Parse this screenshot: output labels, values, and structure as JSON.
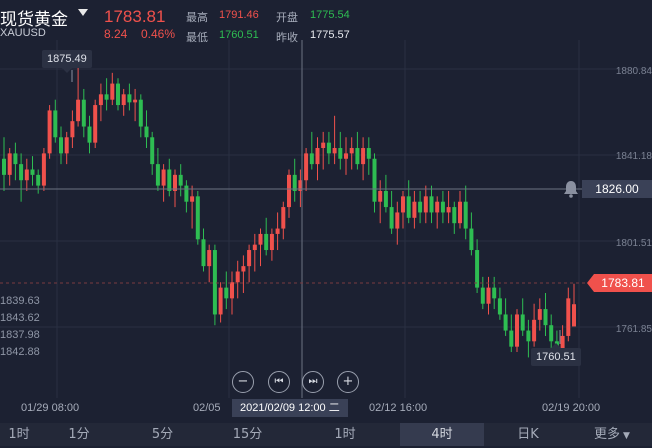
{
  "header": {
    "title": "现货黄金",
    "code": "XAUUSD",
    "price": "1783.81",
    "change": "8.24",
    "change_pct": "0.46%",
    "stats": {
      "high_label": "最高",
      "high_value": "1791.46",
      "open_label": "开盘",
      "open_value": "1775.54",
      "low_label": "最低",
      "low_value": "1760.51",
      "prev_close_label": "昨收",
      "prev_close_value": "1775.57"
    }
  },
  "chart_data": {
    "type": "candlestick",
    "ylim": [
      1750,
      1880
    ],
    "y_tick_labels": [
      "1880.84",
      "1841.18",
      "1801.51",
      "1761.85"
    ],
    "x_tick_labels": [
      "01/29 08:00",
      "02/05",
      "02/12 16:00",
      "02/19 20:00"
    ],
    "series": [
      {
        "ohlc": [
          [
            1838,
            1846,
            1826,
            1832
          ],
          [
            1832,
            1842,
            1828,
            1840
          ],
          [
            1840,
            1844,
            1830,
            1836
          ],
          [
            1836,
            1840,
            1822,
            1830
          ],
          [
            1830,
            1838,
            1826,
            1834
          ],
          [
            1834,
            1839,
            1828,
            1832
          ],
          [
            1832,
            1834,
            1825,
            1828
          ],
          [
            1828,
            1842,
            1826,
            1840
          ],
          [
            1840,
            1858,
            1838,
            1856
          ],
          [
            1856,
            1860,
            1844,
            1846
          ],
          [
            1846,
            1850,
            1836,
            1840
          ],
          [
            1840,
            1848,
            1836,
            1846
          ],
          [
            1846,
            1856,
            1842,
            1852
          ],
          [
            1852,
            1875,
            1850,
            1860
          ],
          [
            1860,
            1864,
            1846,
            1850
          ],
          [
            1850,
            1854,
            1840,
            1844
          ],
          [
            1844,
            1860,
            1842,
            1858
          ],
          [
            1858,
            1866,
            1852,
            1862
          ],
          [
            1862,
            1868,
            1856,
            1860
          ],
          [
            1860,
            1870,
            1858,
            1866
          ],
          [
            1866,
            1868,
            1856,
            1858
          ],
          [
            1858,
            1864,
            1854,
            1862
          ],
          [
            1862,
            1866,
            1856,
            1859
          ],
          [
            1859,
            1864,
            1852,
            1860
          ],
          [
            1860,
            1862,
            1846,
            1850
          ],
          [
            1850,
            1856,
            1842,
            1846
          ],
          [
            1846,
            1848,
            1832,
            1836
          ],
          [
            1836,
            1842,
            1826,
            1828
          ],
          [
            1828,
            1836,
            1822,
            1834
          ],
          [
            1834,
            1838,
            1824,
            1826
          ],
          [
            1826,
            1834,
            1820,
            1832
          ],
          [
            1832,
            1836,
            1824,
            1828
          ],
          [
            1828,
            1830,
            1818,
            1822
          ],
          [
            1822,
            1828,
            1812,
            1824
          ],
          [
            1824,
            1826,
            1806,
            1808
          ],
          [
            1808,
            1812,
            1796,
            1798
          ],
          [
            1798,
            1806,
            1792,
            1804
          ],
          [
            1804,
            1806,
            1776,
            1780
          ],
          [
            1780,
            1792,
            1777,
            1790
          ],
          [
            1790,
            1796,
            1782,
            1786
          ],
          [
            1786,
            1796,
            1780,
            1792
          ],
          [
            1792,
            1800,
            1786,
            1796
          ],
          [
            1796,
            1802,
            1788,
            1798
          ],
          [
            1798,
            1806,
            1792,
            1804
          ],
          [
            1804,
            1810,
            1796,
            1806
          ],
          [
            1806,
            1812,
            1798,
            1810
          ],
          [
            1810,
            1816,
            1802,
            1804
          ],
          [
            1804,
            1812,
            1800,
            1810
          ],
          [
            1810,
            1818,
            1804,
            1812
          ],
          [
            1812,
            1822,
            1808,
            1820
          ],
          [
            1820,
            1834,
            1816,
            1832
          ],
          [
            1832,
            1838,
            1822,
            1826
          ],
          [
            1826,
            1834,
            1820,
            1830
          ],
          [
            1830,
            1842,
            1826,
            1840
          ],
          [
            1840,
            1848,
            1834,
            1836
          ],
          [
            1836,
            1846,
            1830,
            1842
          ],
          [
            1842,
            1848,
            1834,
            1844
          ],
          [
            1844,
            1848,
            1836,
            1840
          ],
          [
            1840,
            1854,
            1836,
            1842
          ],
          [
            1842,
            1848,
            1834,
            1838
          ],
          [
            1838,
            1846,
            1832,
            1840
          ],
          [
            1840,
            1846,
            1834,
            1842
          ],
          [
            1842,
            1848,
            1834,
            1836
          ],
          [
            1836,
            1846,
            1830,
            1842
          ],
          [
            1842,
            1846,
            1832,
            1838
          ],
          [
            1838,
            1840,
            1818,
            1822
          ],
          [
            1822,
            1830,
            1814,
            1826
          ],
          [
            1826,
            1832,
            1818,
            1820
          ],
          [
            1820,
            1826,
            1810,
            1812
          ],
          [
            1812,
            1822,
            1806,
            1818
          ],
          [
            1818,
            1826,
            1812,
            1824
          ],
          [
            1824,
            1830,
            1814,
            1816
          ],
          [
            1816,
            1826,
            1812,
            1822
          ],
          [
            1822,
            1826,
            1814,
            1818
          ],
          [
            1818,
            1828,
            1814,
            1824
          ],
          [
            1824,
            1828,
            1814,
            1818
          ],
          [
            1818,
            1824,
            1812,
            1822
          ],
          [
            1822,
            1826,
            1814,
            1818
          ],
          [
            1818,
            1826,
            1814,
            1820
          ],
          [
            1820,
            1822,
            1810,
            1814
          ],
          [
            1814,
            1826,
            1812,
            1822
          ],
          [
            1822,
            1828,
            1808,
            1812
          ],
          [
            1812,
            1818,
            1802,
            1804
          ],
          [
            1804,
            1808,
            1788,
            1790
          ],
          [
            1790,
            1794,
            1782,
            1784
          ],
          [
            1784,
            1794,
            1780,
            1790
          ],
          [
            1790,
            1794,
            1782,
            1786
          ],
          [
            1786,
            1790,
            1778,
            1780
          ],
          [
            1780,
            1786,
            1772,
            1774
          ],
          [
            1774,
            1780,
            1766,
            1768
          ],
          [
            1768,
            1782,
            1766,
            1780
          ],
          [
            1780,
            1786,
            1772,
            1774
          ],
          [
            1774,
            1778,
            1764,
            1770
          ],
          [
            1770,
            1784,
            1768,
            1778
          ],
          [
            1778,
            1786,
            1774,
            1782
          ],
          [
            1782,
            1788,
            1772,
            1776
          ],
          [
            1776,
            1780,
            1766,
            1770
          ],
          [
            1770,
            1774,
            1761,
            1766
          ],
          [
            1766,
            1776,
            1762,
            1772
          ],
          [
            1772,
            1790,
            1770,
            1786
          ],
          [
            1775.54,
            1791.46,
            1778,
            1783.81
          ]
        ]
      }
    ],
    "high_marker": "1875.49",
    "low_marker": "1760.51",
    "crosshair_price": "1826.00",
    "crosshair_date": "2021/02/09 12:00 二",
    "last_price": "1783.81",
    "ma_values": [
      "1839.63",
      "1843.62",
      "1837.98",
      "1842.88"
    ]
  },
  "controls": {
    "zoom_out": "−",
    "prev": "⏮",
    "next": "⏭",
    "zoom_in": "+"
  },
  "tabs": [
    "1时",
    "1分",
    "5分",
    "15分",
    "1时",
    "4时",
    "日K",
    "更多"
  ],
  "active_tab": 5,
  "colors": {
    "up": "#f0514c",
    "down": "#2ebd52",
    "background": "#1c2132"
  }
}
